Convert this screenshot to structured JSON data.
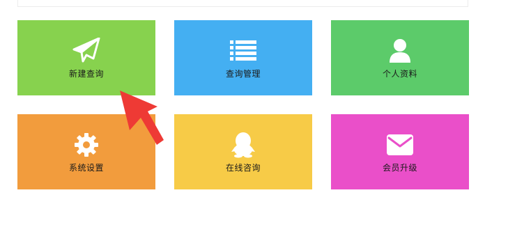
{
  "tiles": [
    {
      "label": "新建查询",
      "icon": "paper-plane-icon",
      "color": "#87d24e"
    },
    {
      "label": "查询管理",
      "icon": "list-icon",
      "color": "#44aff2"
    },
    {
      "label": "个人资料",
      "icon": "user-icon",
      "color": "#5ccb6a"
    },
    {
      "label": "系统设置",
      "icon": "gear-icon",
      "color": "#f29c3d"
    },
    {
      "label": "在线咨询",
      "icon": "qq-penguin-icon",
      "color": "#f7cb47"
    },
    {
      "label": "会员升级",
      "icon": "envelope-icon",
      "color": "#ea4fc9"
    }
  ],
  "overlay": {
    "annotation_color": "#ee3a35"
  }
}
